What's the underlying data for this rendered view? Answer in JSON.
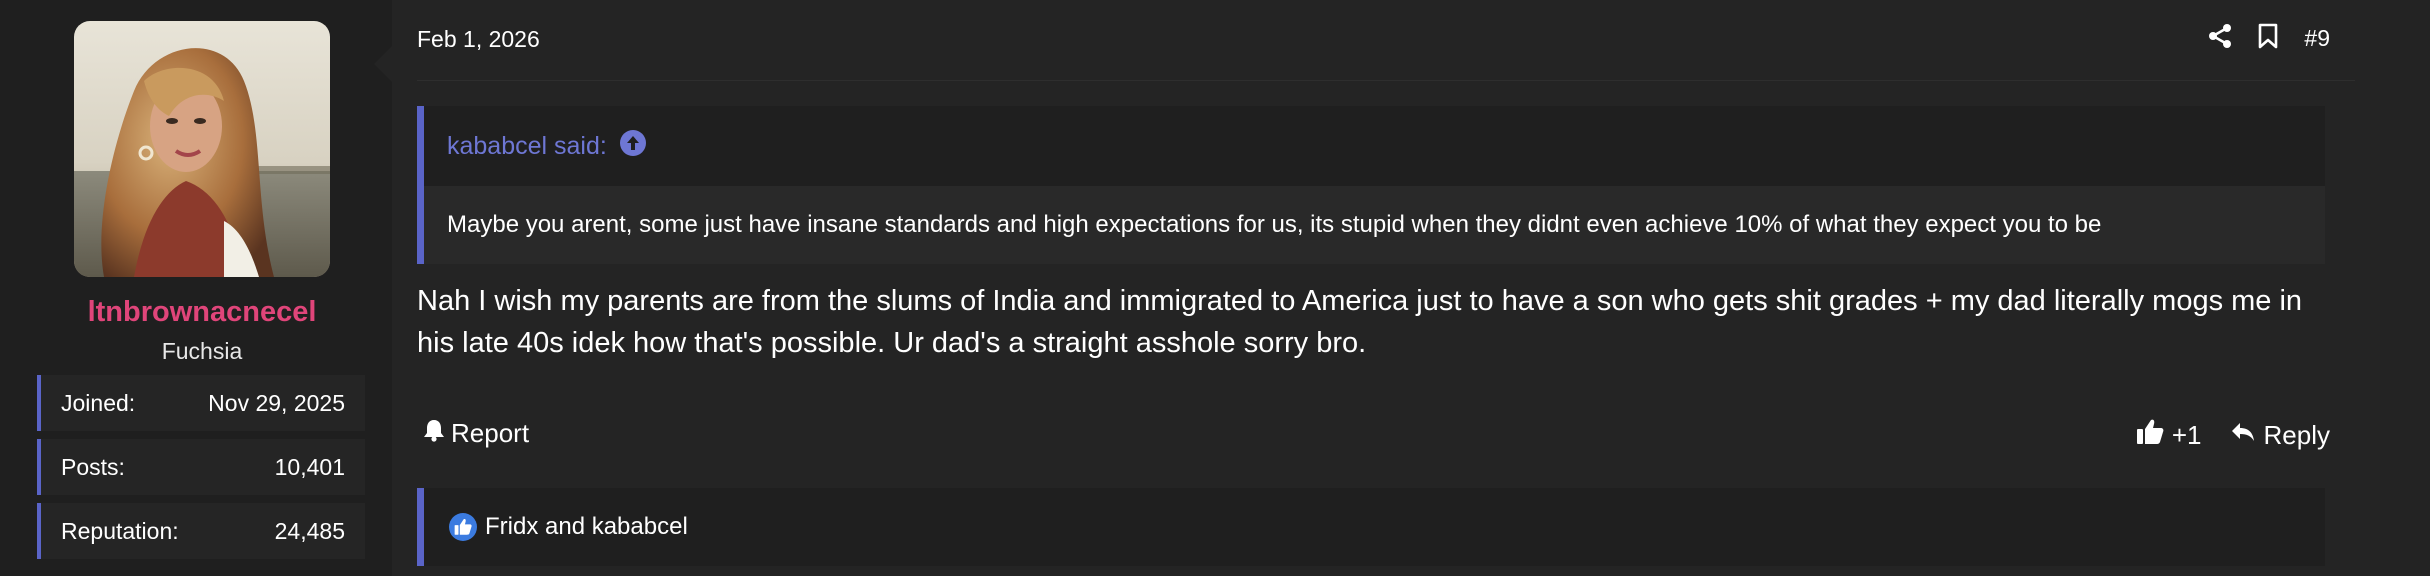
{
  "user": {
    "username": "ltnbrownacnecel",
    "user_title": "Fuchsia",
    "stats": [
      {
        "label": "Joined:",
        "value": "Nov 29, 2025"
      },
      {
        "label": "Posts:",
        "value": "10,401"
      },
      {
        "label": "Reputation:",
        "value": "24,485"
      }
    ]
  },
  "post": {
    "date": "Feb 1, 2026",
    "number": "#9",
    "icons": {
      "share": "share-icon",
      "bookmark": "bookmark-icon"
    },
    "quote": {
      "author_line": "kababcel said:",
      "text": "Maybe you arent, some just have insane standards and high expectations for us, its stupid when they didnt even achieve 10% of what they expect you to be"
    },
    "message": "Nah I wish my parents are from the slums of India and immigrated to America just to have a son who gets shit grades + my dad literally mogs me in his late 40s idek how that's possible. Ur dad's a straight asshole sorry bro.",
    "footer": {
      "report_label": "Report",
      "like_count": "+1",
      "reply_label": "Reply"
    },
    "reactions_text": "Fridx and kababcel"
  },
  "colors": {
    "accent": "#5a64c8",
    "username": "#e0457a",
    "quote_link": "#6e77d4",
    "like_badge": "#3b7be0"
  }
}
